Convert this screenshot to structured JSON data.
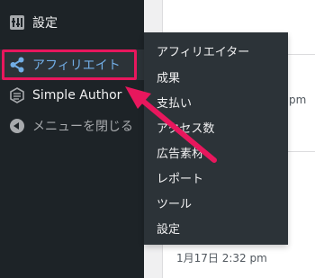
{
  "sidebar": {
    "items": [
      {
        "label": "設定",
        "icon": "settings-sliders-icon"
      },
      {
        "label": "アフィリエイト",
        "icon": "share-icon",
        "active": true
      },
      {
        "label": "Simple Author",
        "icon": "hexagon-icon"
      },
      {
        "label": "メニューを閉じる",
        "icon": "collapse-arrow-icon"
      }
    ]
  },
  "submenu": {
    "items": [
      {
        "label": "アフィリエイター"
      },
      {
        "label": "成果"
      },
      {
        "label": "支払い"
      },
      {
        "label": "アクセス数"
      },
      {
        "label": "広告素材"
      },
      {
        "label": "レポート"
      },
      {
        "label": "ツール"
      },
      {
        "label": "設定"
      }
    ]
  },
  "background": {
    "time_fragment": "pm",
    "date_text": "1月17日 2:32 pm"
  },
  "colors": {
    "sidebar_bg": "#1d2327",
    "submenu_bg": "#2c3338",
    "active_text": "#72aee6",
    "annotation": "#e8175d"
  }
}
